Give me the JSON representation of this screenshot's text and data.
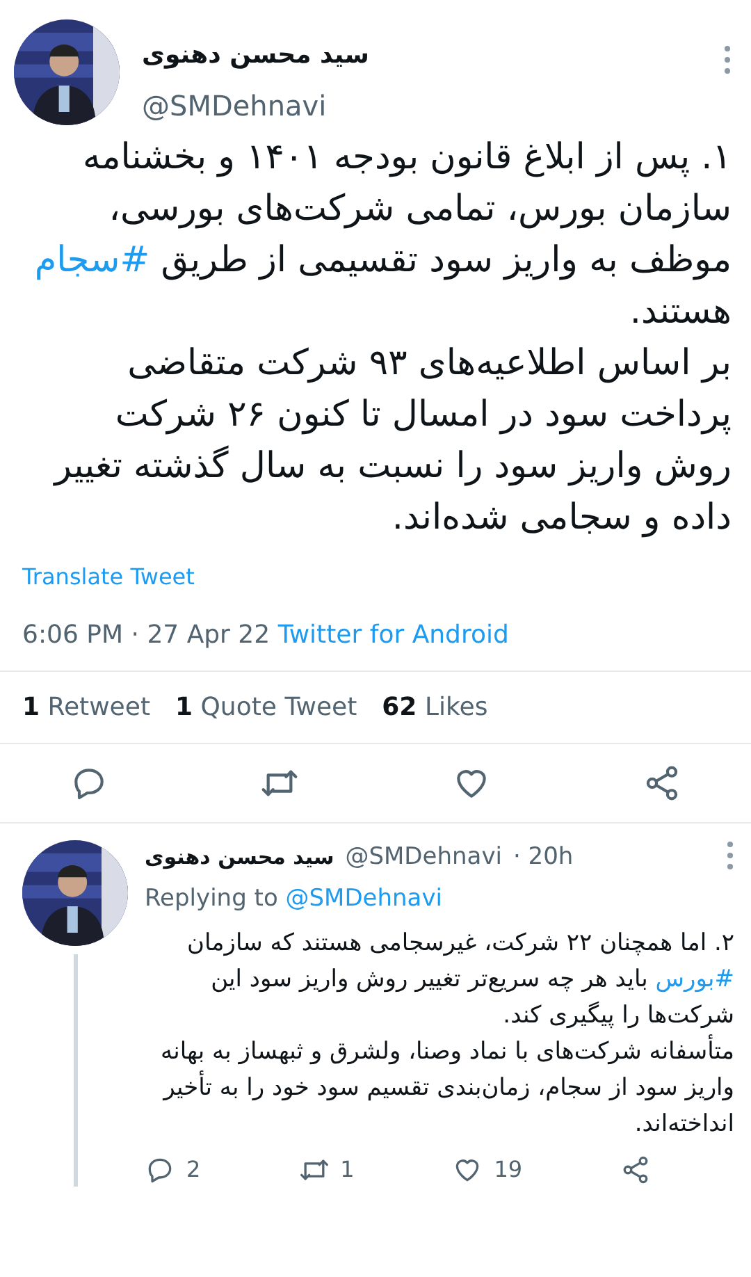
{
  "tweet": {
    "author": {
      "name": "سید محسن دهنوی",
      "handle": "@SMDehnavi"
    },
    "paragraphs": [
      [
        {
          "kind": "text",
          "text": "۱. پس از ابلاغ قانون بودجه ۱۴۰۱ و بخشنامه سازمان بورس، تمامی شرکت‌های بورسی، موظف به واریز سود تقسیمی از طریق "
        },
        {
          "kind": "hashtag",
          "text": "#سجام"
        },
        {
          "kind": "text",
          "text": " هستند."
        }
      ],
      [
        {
          "kind": "text",
          "text": "بر اساس اطلاعیه‌های ۹۳ شرکت متقاضی پرداخت سود در امسال تا کنون ۲۶ شرکت روش واریز سود را نسبت به سال گذشته تغییر داده و سجامی شده‌اند."
        }
      ]
    ],
    "translate": "Translate Tweet",
    "time": "6:06 PM · 27 Apr 22",
    "source": "Twitter for Android",
    "stats": {
      "retweets": {
        "count": "1",
        "label": "Retweet"
      },
      "quote_tweets": {
        "count": "1",
        "label": "Quote Tweet"
      },
      "likes": {
        "count": "62",
        "label": "Likes"
      }
    },
    "actions": [
      {
        "kind": "reply"
      },
      {
        "kind": "retweet"
      },
      {
        "kind": "like"
      },
      {
        "kind": "share"
      }
    ]
  },
  "reply": {
    "author": {
      "name": "سید محسن دهنوی",
      "handle": "@SMDehnavi",
      "age": "· 20h"
    },
    "replying_label": "Replying to",
    "replying_to": "@SMDehnavi",
    "paragraphs": [
      [
        {
          "kind": "text",
          "text": "۲. اما همچنان ۲۲ شرکت، غیرسجامی هستند که سازمان "
        },
        {
          "kind": "hashtag",
          "text": "#بورس"
        },
        {
          "kind": "text",
          "text": " باید هر چه سریع‌تر تغییر روش واریز سود این شرکت‌ها را پیگیری کند."
        }
      ],
      [
        {
          "kind": "text",
          "text": "متأسفانه شرکت‌های با نماد وصنا، ولشرق و ثبهساز به بهانه واریز سود از سجام، زمان‌بندی تقسیم سود خود را به تأخیر انداخته‌اند."
        }
      ]
    ],
    "actions": {
      "reply": {
        "kind": "reply",
        "count": "2"
      },
      "retweet": {
        "kind": "retweet",
        "count": "1"
      },
      "like": {
        "kind": "like",
        "count": "19"
      },
      "share": {
        "kind": "share"
      }
    }
  }
}
